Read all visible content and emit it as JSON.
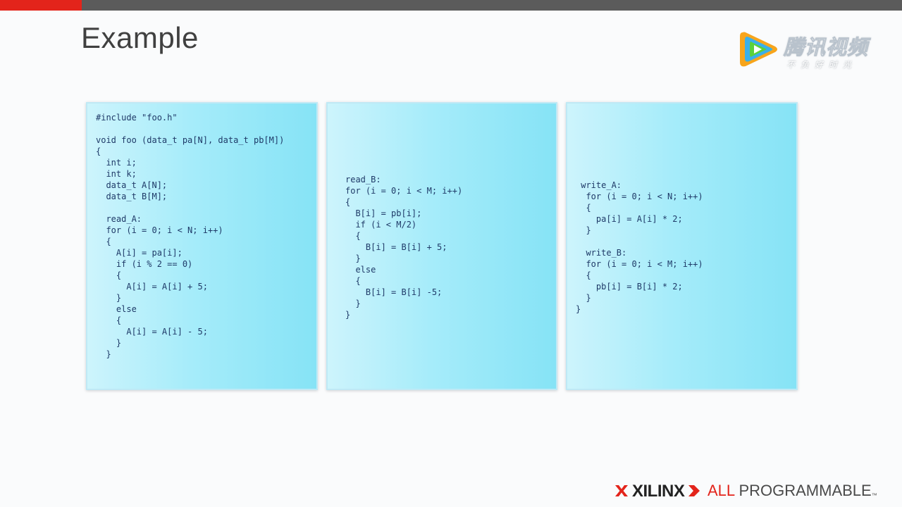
{
  "slide": {
    "title": "Example"
  },
  "watermark": {
    "name": "腾讯视频",
    "slogan": "不负好时光"
  },
  "panels": [
    {
      "code": "#include \"foo.h\"\n\nvoid foo (data_t pa[N], data_t pb[M])\n{\n  int i;\n  int k;\n  data_t A[N];\n  data_t B[M];\n\n  read_A:\n  for (i = 0; i < N; i++)\n  {\n    A[i] = pa[i];\n    if (i % 2 == 0)\n    {\n      A[i] = A[i] + 5;\n    }\n    else\n    {\n      A[i] = A[i] - 5;\n    }\n  }"
    },
    {
      "code": "read_B:\nfor (i = 0; i < M; i++)\n{\n  B[i] = pb[i];\n  if (i < M/2)\n  {\n    B[i] = B[i] + 5;\n  }\n  else\n  {\n    B[i] = B[i] -5;\n  }\n}"
    },
    {
      "code": " write_A:\n  for (i = 0; i < N; i++)\n  {\n    pa[i] = A[i] * 2;\n  }\n\n  write_B:\n  for (i = 0; i < M; i++)\n  {\n    pb[i] = B[i] * 2;\n  }\n}"
    }
  ],
  "footer": {
    "brand": "XILINX",
    "tagline_all": "ALL",
    "tagline_rest": "PROGRAMMABLE",
    "trademark": "™"
  },
  "colors": {
    "accent_red": "#e3241b",
    "topbar": "#5b5b5b",
    "code_text": "#1f3a68",
    "panel_cyan": "#a6ecfa"
  },
  "icons": {
    "watermark": "tencent-video-play-logo",
    "footer_mark": "xilinx-x-mark",
    "footer_chevron": "red-chevron"
  }
}
